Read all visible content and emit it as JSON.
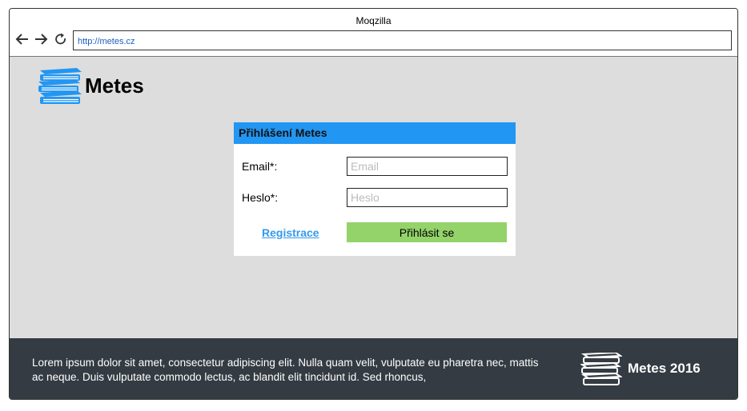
{
  "window": {
    "title": "Moqzilla",
    "url": "http://metes.cz"
  },
  "header": {
    "brand": "Metes",
    "logo_icon": "books-icon"
  },
  "login": {
    "title": "Přihlášení Metes",
    "email_label": "Email*:",
    "email_placeholder": "Email",
    "password_label": "Heslo*:",
    "password_placeholder": "Heslo",
    "register_link": "Registrace",
    "submit_label": "Přihlásit se"
  },
  "footer": {
    "text": "Lorem ipsum dolor sit amet, consectetur adipiscing elit. Nulla quam velit, vulputate eu pharetra nec, mattis ac neque. Duis vulputate commodo lectus, ac blandit elit tincidunt id. Sed rhoncus,",
    "brand": "Metes 2016",
    "logo_icon": "books-icon"
  },
  "colors": {
    "accent": "#2196f3",
    "submit": "#93d36a",
    "footer_bg": "#343b42",
    "page_bg": "#dddddd"
  }
}
